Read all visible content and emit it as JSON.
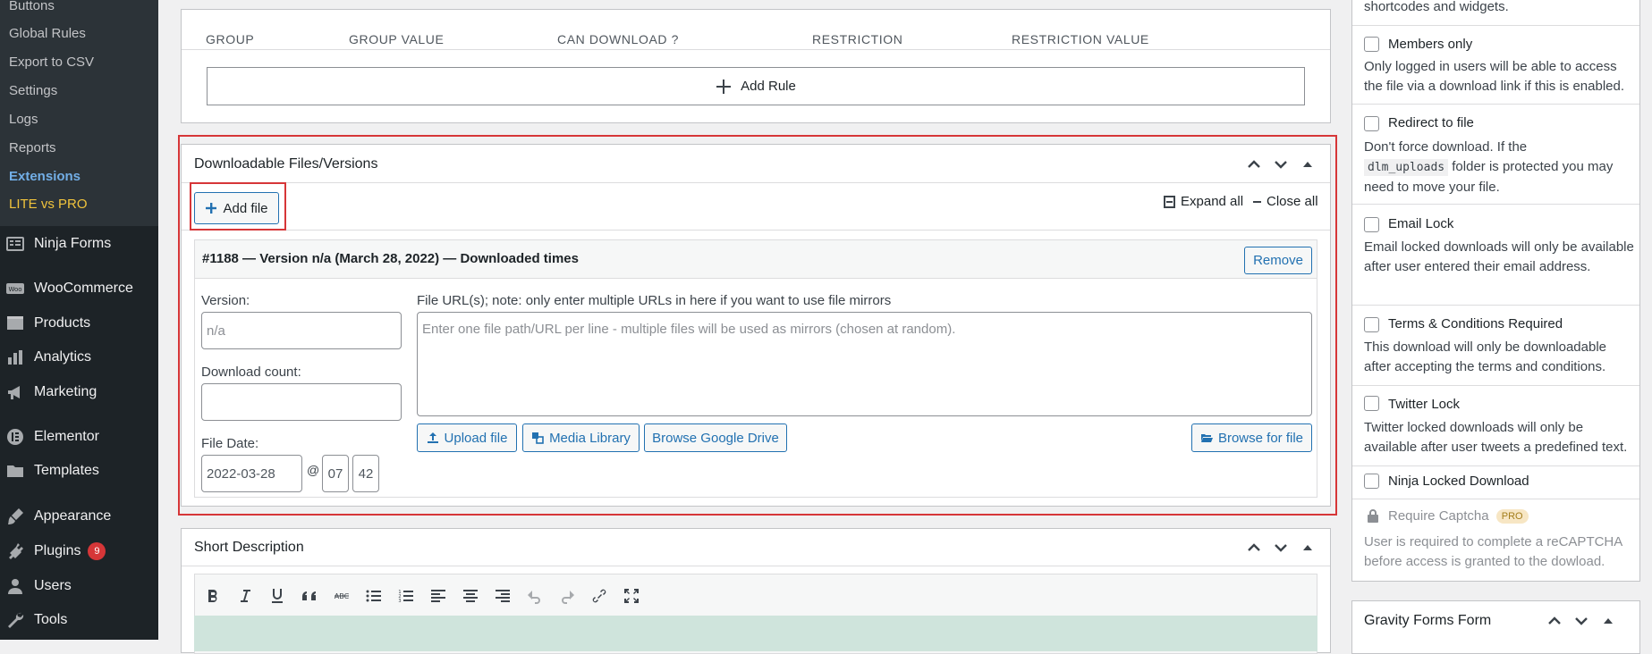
{
  "sidebar": {
    "submenu": [
      "Buttons",
      "Global Rules",
      "Export to CSV",
      "Settings",
      "Logs",
      "Reports",
      "Extensions",
      "LITE vs PRO"
    ],
    "menu": [
      {
        "label": "Ninja Forms",
        "icon": "ninja-forms-icon"
      },
      {
        "label": "WooCommerce",
        "icon": "woocommerce-icon"
      },
      {
        "label": "Products",
        "icon": "products-icon"
      },
      {
        "label": "Analytics",
        "icon": "analytics-icon"
      },
      {
        "label": "Marketing",
        "icon": "megaphone-icon"
      },
      {
        "label": "Elementor",
        "icon": "elementor-icon"
      },
      {
        "label": "Templates",
        "icon": "folder-icon"
      },
      {
        "label": "Appearance",
        "icon": "brush-icon"
      },
      {
        "label": "Plugins",
        "icon": "plugin-icon",
        "badge": "9"
      },
      {
        "label": "Users",
        "icon": "user-icon"
      },
      {
        "label": "Tools",
        "icon": "wrench-icon"
      }
    ]
  },
  "rules": {
    "headers": [
      "GROUP",
      "GROUP VALUE",
      "CAN DOWNLOAD ?",
      "RESTRICTION",
      "RESTRICTION VALUE"
    ],
    "add_rule": "Add Rule"
  },
  "files": {
    "title": "Downloadable Files/Versions",
    "add_file": "Add file",
    "expand_all": "Expand all",
    "close_all": "Close all",
    "version_heading": "#1188 — Version n/a (March 28, 2022) — Downloaded times",
    "remove": "Remove",
    "version_label": "Version:",
    "version_placeholder": "n/a",
    "download_count_label": "Download count:",
    "file_date_label": "File Date:",
    "file_date": "2022-03-28",
    "at": "@",
    "hour": "07",
    "minute": "42",
    "urls_label": "File URL(s); note: only enter multiple URLs in here if you want to use file mirrors",
    "urls_placeholder": "Enter one file path/URL per line - multiple files will be used as mirrors (chosen at random).",
    "upload_file": "Upload file",
    "media_library": "Media Library",
    "browse_drive": "Browse Google Drive",
    "browse_file": "Browse for file"
  },
  "short_description": {
    "title": "Short Description"
  },
  "options": {
    "top_desc": "shortcodes and widgets.",
    "members_only": {
      "title": "Members only",
      "desc": "Only logged in users will be able to access the file via a download link if this is enabled."
    },
    "redirect": {
      "title": "Redirect to file",
      "desc_a": "Don't force download. If the",
      "code": "dlm_uploads",
      "desc_b": "folder is protected you may need to move your file."
    },
    "email_lock": {
      "title": "Email Lock",
      "desc": "Email locked downloads will only be available after user entered their email address."
    },
    "terms": {
      "title": "Terms & Conditions Required",
      "desc": "This download will only be downloadable after accepting the terms and conditions."
    },
    "twitter": {
      "title": "Twitter Lock",
      "desc": "Twitter locked downloads will only be available after user tweets a predefined text."
    },
    "ninja": {
      "title": "Ninja Locked Download"
    },
    "captcha": {
      "title": "Require Captcha",
      "badge": "PRO",
      "desc": "User is required to complete a reCAPTCHA before access is granted to the dowload."
    }
  },
  "gravity": {
    "title": "Gravity Forms Form"
  },
  "colors": {
    "highlight": "#d63638",
    "accent": "#2271b1",
    "sidebar": "#1d2327",
    "editor_bg": "#cfe4dc"
  }
}
